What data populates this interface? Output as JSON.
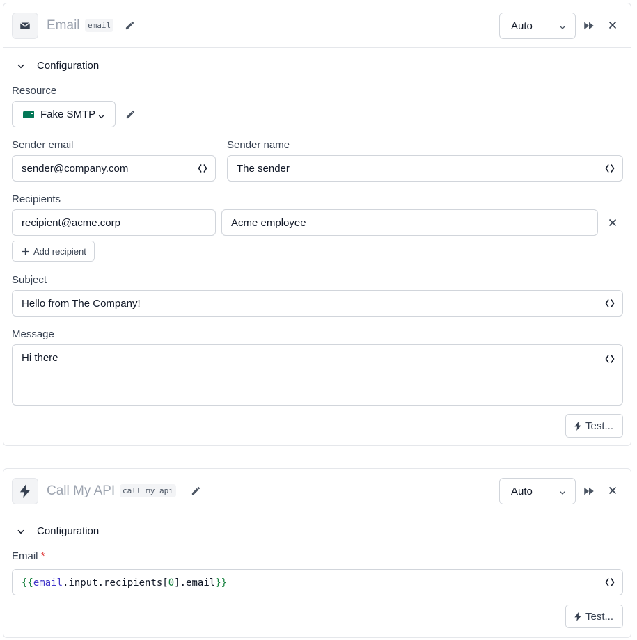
{
  "steps": [
    {
      "title": "Email",
      "id": "email",
      "mode": "Auto",
      "config_title": "Configuration",
      "resource_label": "Resource",
      "resource_value": "Fake SMTP",
      "sender_email_label": "Sender email",
      "sender_email_value": "sender@company.com",
      "sender_name_label": "Sender name",
      "sender_name_value": "The sender",
      "recipients_label": "Recipients",
      "recipients": [
        {
          "email": "recipient@acme.corp",
          "name": "Acme employee"
        }
      ],
      "add_recipient_label": "Add recipient",
      "subject_label": "Subject",
      "subject_value": "Hello from The Company!",
      "message_label": "Message",
      "message_value": "Hi there",
      "test_label": "Test..."
    },
    {
      "title": "Call My API",
      "id": "call_my_api",
      "mode": "Auto",
      "config_title": "Configuration",
      "email_label": "Email",
      "required_marker": "*",
      "email_expr": {
        "open": "{{",
        "ident": "email",
        "path1": ".input.recipients[",
        "index": "0",
        "path2": "].email",
        "close": "}}"
      },
      "test_label": "Test..."
    }
  ],
  "icons": {
    "email_step": "envelope-icon",
    "api_step": "lightning-bolt-icon",
    "resource": "mailbox-icon",
    "edit": "pencil-icon",
    "run": "fast-forward-icon",
    "close": "close-icon",
    "template": "braces-icon"
  },
  "colors": {
    "brand_green": "#047857",
    "required_red": "#dc2626",
    "muted_text": "#9ca3af",
    "border": "#d1d5db"
  }
}
